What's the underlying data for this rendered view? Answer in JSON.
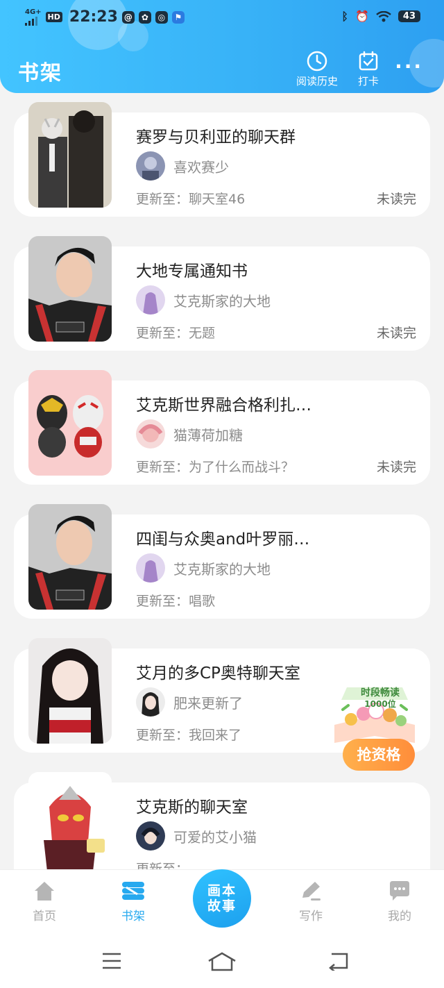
{
  "status_bar": {
    "network": "4G+",
    "hd_badge": "HD",
    "time": "22:23",
    "app_icons": [
      "@",
      "✿",
      "◎",
      "⚑"
    ],
    "battery": "43"
  },
  "header": {
    "title": "书架",
    "history_label": "阅读历史",
    "checkin_label": "打卡",
    "more_icon": "more-dots-icon"
  },
  "books": [
    {
      "title": "赛罗与贝利亚的聊天群",
      "author": "喜欢赛少",
      "update": "更新至：聊天室46",
      "status": "未读完"
    },
    {
      "title": "大地专属通知书",
      "author": "艾克斯家的大地",
      "update": "更新至：无题",
      "status": "未读完"
    },
    {
      "title": "艾克斯世界融合格利扎…",
      "author": "猫薄荷加糖",
      "update": "更新至：为了什么而战斗？",
      "status": "未读完"
    },
    {
      "title": "四闺与众奥and叶罗丽…",
      "author": "艾克斯家的大地",
      "update": "更新至：唱歌",
      "status": ""
    },
    {
      "title": "艾月的多CP奥特聊天室",
      "author": "肥来更新了",
      "update": "更新至：我回来了",
      "status": ""
    },
    {
      "title": "艾克斯的聊天室",
      "author": "可爱的艾小猫",
      "update": "更新至：",
      "status": ""
    }
  ],
  "promo": {
    "line1": "时段畅读",
    "line2": "1000位",
    "button": "抢资格"
  },
  "tabbar": {
    "home": "首页",
    "shelf": "书架",
    "center_line1": "画本",
    "center_line2": "故事",
    "write": "写作",
    "mine": "我的"
  },
  "colors": {
    "accent": "#27a9ef",
    "header_gradient_start": "#43c4ff",
    "promo_orange": "#ff8d3a"
  }
}
